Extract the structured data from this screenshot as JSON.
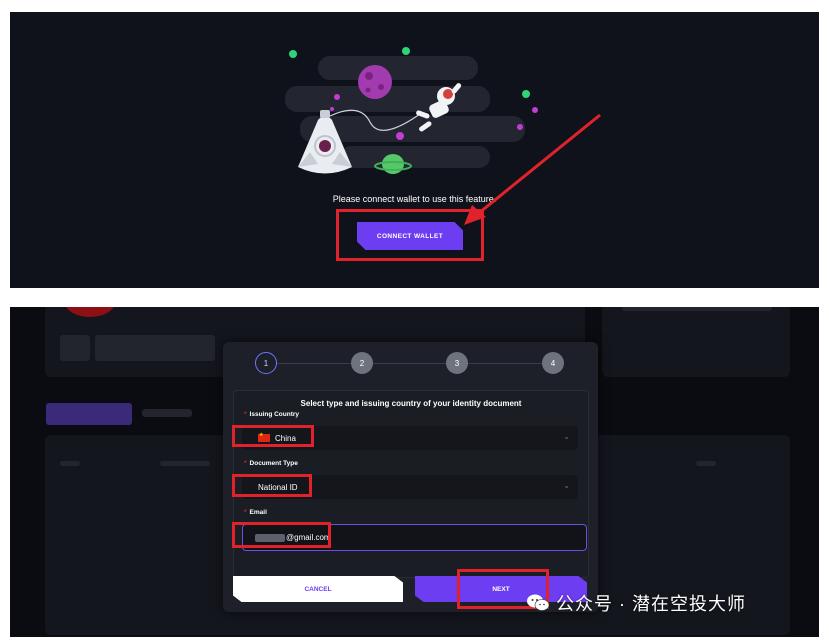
{
  "top": {
    "prompt": "Please connect wallet to use this feature.",
    "connect_button": "CONNECT WALLET"
  },
  "modal": {
    "steps": [
      "1",
      "2",
      "3",
      "4"
    ],
    "active_step": 1,
    "title": "Select type and issuing country of your identity document",
    "issuing_country": {
      "label": "Issuing Country",
      "value": "China"
    },
    "document_type": {
      "label": "Document Type",
      "value": "National ID"
    },
    "email": {
      "label": "Email",
      "value": "@gmail.com"
    },
    "cancel_button": "CANCEL",
    "next_button": "NEXT"
  },
  "watermark": "公众号 · 潜在空投大师",
  "colors": {
    "accent": "#6d3df2",
    "highlight_box": "#e0232a",
    "top_bg": "#10121b",
    "modal_bg": "#1d2028"
  }
}
